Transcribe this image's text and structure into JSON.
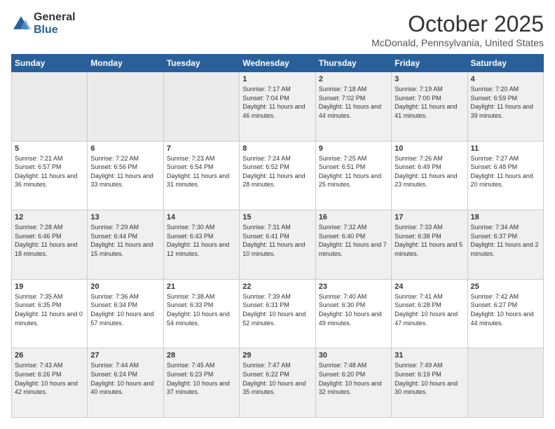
{
  "header": {
    "logo_general": "General",
    "logo_blue": "Blue",
    "title": "October 2025",
    "subtitle": "McDonald, Pennsylvania, United States"
  },
  "days_of_week": [
    "Sunday",
    "Monday",
    "Tuesday",
    "Wednesday",
    "Thursday",
    "Friday",
    "Saturday"
  ],
  "weeks": [
    [
      {
        "day": "",
        "info": ""
      },
      {
        "day": "",
        "info": ""
      },
      {
        "day": "",
        "info": ""
      },
      {
        "day": "1",
        "info": "Sunrise: 7:17 AM\nSunset: 7:04 PM\nDaylight: 11 hours and 46 minutes."
      },
      {
        "day": "2",
        "info": "Sunrise: 7:18 AM\nSunset: 7:02 PM\nDaylight: 11 hours and 44 minutes."
      },
      {
        "day": "3",
        "info": "Sunrise: 7:19 AM\nSunset: 7:00 PM\nDaylight: 11 hours and 41 minutes."
      },
      {
        "day": "4",
        "info": "Sunrise: 7:20 AM\nSunset: 6:59 PM\nDaylight: 11 hours and 39 minutes."
      }
    ],
    [
      {
        "day": "5",
        "info": "Sunrise: 7:21 AM\nSunset: 6:57 PM\nDaylight: 11 hours and 36 minutes."
      },
      {
        "day": "6",
        "info": "Sunrise: 7:22 AM\nSunset: 6:56 PM\nDaylight: 11 hours and 33 minutes."
      },
      {
        "day": "7",
        "info": "Sunrise: 7:23 AM\nSunset: 6:54 PM\nDaylight: 11 hours and 31 minutes."
      },
      {
        "day": "8",
        "info": "Sunrise: 7:24 AM\nSunset: 6:52 PM\nDaylight: 11 hours and 28 minutes."
      },
      {
        "day": "9",
        "info": "Sunrise: 7:25 AM\nSunset: 6:51 PM\nDaylight: 11 hours and 25 minutes."
      },
      {
        "day": "10",
        "info": "Sunrise: 7:26 AM\nSunset: 6:49 PM\nDaylight: 11 hours and 23 minutes."
      },
      {
        "day": "11",
        "info": "Sunrise: 7:27 AM\nSunset: 6:48 PM\nDaylight: 11 hours and 20 minutes."
      }
    ],
    [
      {
        "day": "12",
        "info": "Sunrise: 7:28 AM\nSunset: 6:46 PM\nDaylight: 11 hours and 18 minutes."
      },
      {
        "day": "13",
        "info": "Sunrise: 7:29 AM\nSunset: 6:44 PM\nDaylight: 11 hours and 15 minutes."
      },
      {
        "day": "14",
        "info": "Sunrise: 7:30 AM\nSunset: 6:43 PM\nDaylight: 11 hours and 12 minutes."
      },
      {
        "day": "15",
        "info": "Sunrise: 7:31 AM\nSunset: 6:41 PM\nDaylight: 11 hours and 10 minutes."
      },
      {
        "day": "16",
        "info": "Sunrise: 7:32 AM\nSunset: 6:40 PM\nDaylight: 11 hours and 7 minutes."
      },
      {
        "day": "17",
        "info": "Sunrise: 7:33 AM\nSunset: 6:38 PM\nDaylight: 11 hours and 5 minutes."
      },
      {
        "day": "18",
        "info": "Sunrise: 7:34 AM\nSunset: 6:37 PM\nDaylight: 11 hours and 2 minutes."
      }
    ],
    [
      {
        "day": "19",
        "info": "Sunrise: 7:35 AM\nSunset: 6:35 PM\nDaylight: 11 hours and 0 minutes."
      },
      {
        "day": "20",
        "info": "Sunrise: 7:36 AM\nSunset: 6:34 PM\nDaylight: 10 hours and 57 minutes."
      },
      {
        "day": "21",
        "info": "Sunrise: 7:38 AM\nSunset: 6:33 PM\nDaylight: 10 hours and 54 minutes."
      },
      {
        "day": "22",
        "info": "Sunrise: 7:39 AM\nSunset: 6:31 PM\nDaylight: 10 hours and 52 minutes."
      },
      {
        "day": "23",
        "info": "Sunrise: 7:40 AM\nSunset: 6:30 PM\nDaylight: 10 hours and 49 minutes."
      },
      {
        "day": "24",
        "info": "Sunrise: 7:41 AM\nSunset: 6:28 PM\nDaylight: 10 hours and 47 minutes."
      },
      {
        "day": "25",
        "info": "Sunrise: 7:42 AM\nSunset: 6:27 PM\nDaylight: 10 hours and 44 minutes."
      }
    ],
    [
      {
        "day": "26",
        "info": "Sunrise: 7:43 AM\nSunset: 6:26 PM\nDaylight: 10 hours and 42 minutes."
      },
      {
        "day": "27",
        "info": "Sunrise: 7:44 AM\nSunset: 6:24 PM\nDaylight: 10 hours and 40 minutes."
      },
      {
        "day": "28",
        "info": "Sunrise: 7:45 AM\nSunset: 6:23 PM\nDaylight: 10 hours and 37 minutes."
      },
      {
        "day": "29",
        "info": "Sunrise: 7:47 AM\nSunset: 6:22 PM\nDaylight: 10 hours and 35 minutes."
      },
      {
        "day": "30",
        "info": "Sunrise: 7:48 AM\nSunset: 6:20 PM\nDaylight: 10 hours and 32 minutes."
      },
      {
        "day": "31",
        "info": "Sunrise: 7:49 AM\nSunset: 6:19 PM\nDaylight: 10 hours and 30 minutes."
      },
      {
        "day": "",
        "info": ""
      }
    ]
  ]
}
